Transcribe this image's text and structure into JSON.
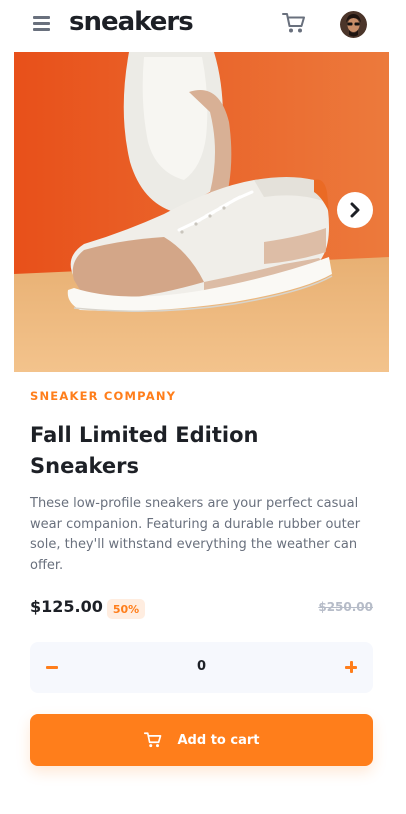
{
  "header": {
    "logo": "sneakers",
    "menu_icon": "hamburger-menu-icon",
    "cart_icon": "cart-icon",
    "avatar_icon": "user-avatar"
  },
  "gallery": {
    "next_icon": "chevron-right-icon"
  },
  "product": {
    "company": "SNEAKER COMPANY",
    "title": "Fall Limited Edition Sneakers",
    "description": "These low-profile sneakers are your perfect casual wear companion. Featuring a durable rubber outer sole, they'll withstand everything the weather can offer.",
    "price": "$125.00",
    "discount": "50%",
    "original_price": "$250.00"
  },
  "quantity": {
    "value": "0",
    "minus_icon": "minus-icon",
    "plus_icon": "plus-icon"
  },
  "cta": {
    "label": "Add to cart",
    "icon": "cart-icon"
  },
  "colors": {
    "accent": "#ff7e1b",
    "accent_pale": "#ffede0",
    "text_dark": "#1d2026",
    "text_grey": "#69707d",
    "text_light": "#b6bcc8",
    "surface": "#f6f8fd"
  }
}
